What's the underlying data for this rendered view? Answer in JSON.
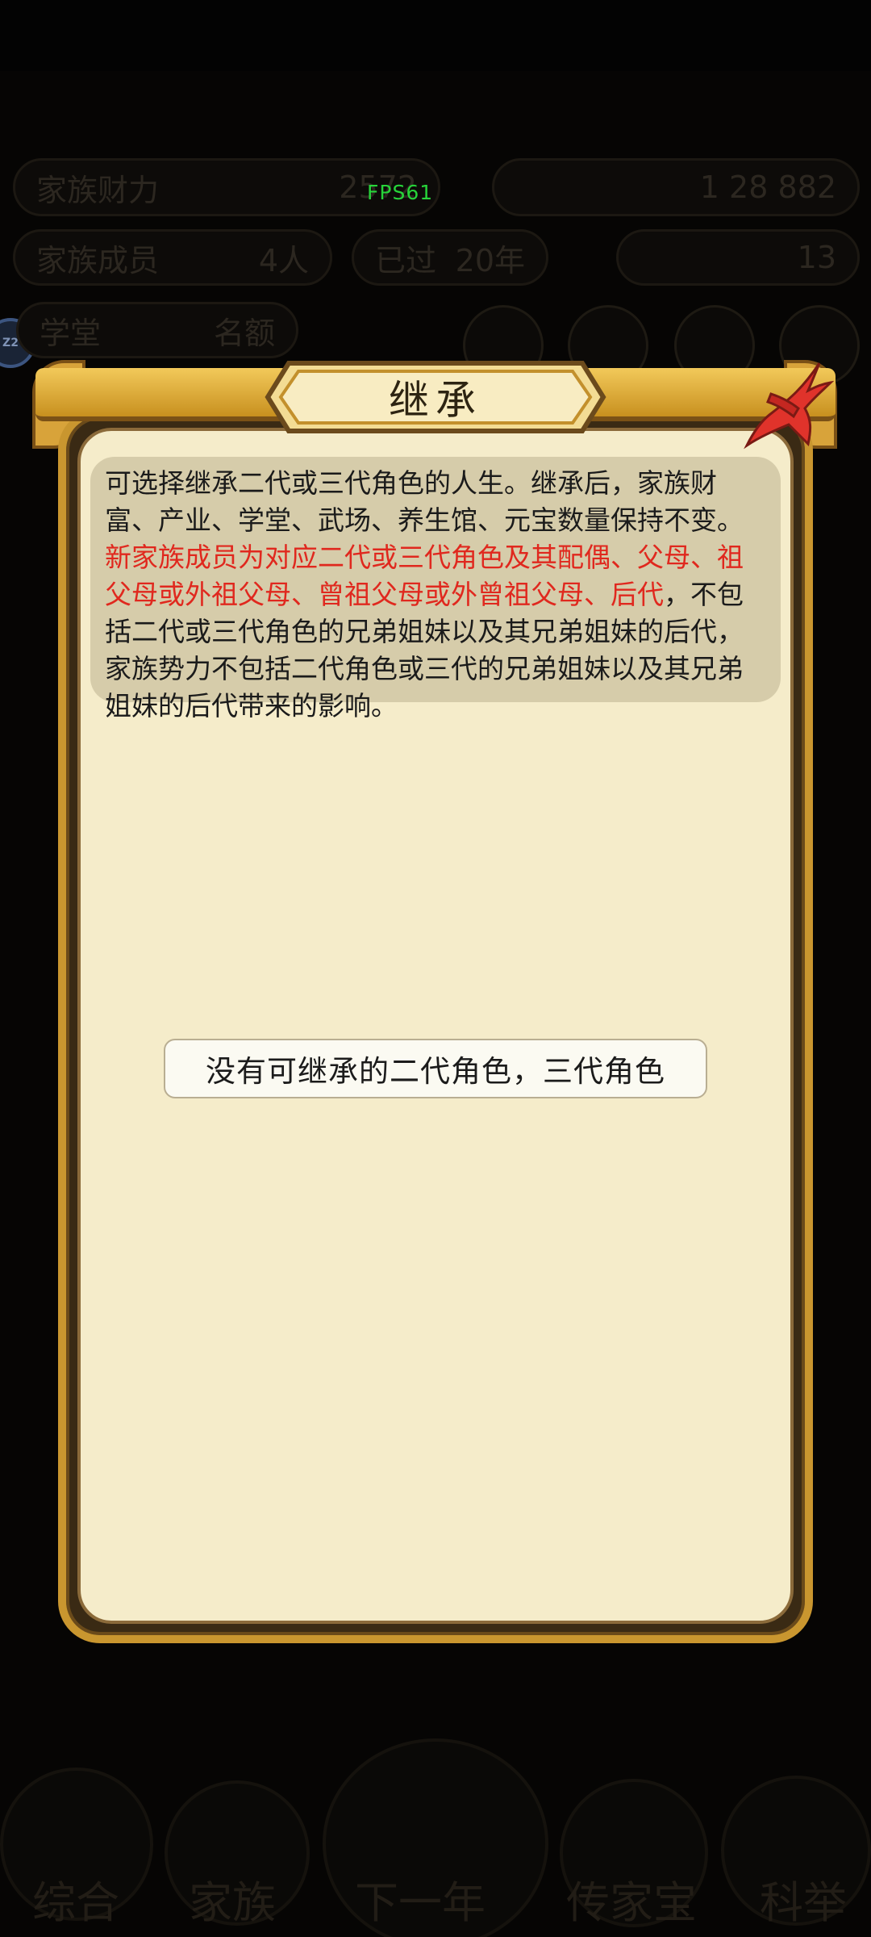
{
  "status": {
    "fps": "FPS61"
  },
  "background": {
    "stats_left": {
      "label": "家族财力",
      "value": "2572"
    },
    "stats_right": {
      "text": "1 28 882"
    },
    "members": {
      "label": "家族成员",
      "value": "4人"
    },
    "time": {
      "label": "已过",
      "value": "20年"
    },
    "currency": {
      "value": "13"
    },
    "scholar": {
      "label": "学堂",
      "value": "名额"
    },
    "avatar_label": "Z2"
  },
  "dialog": {
    "title": "继承",
    "info_plain_1": "可选择继承二代或三代角色的人生。继承后，家族财富、产业、学堂、武场、养生馆、元宝数量保持不变。",
    "info_red": "新家族成员为对应二代或三代角色及其配偶、父母、祖父母或外祖父母、曾祖父母或外曾祖父母、后代",
    "info_plain_2": "，不包括二代或三代角色的兄弟姐妹以及其兄弟姐妹的后代，家族势力不包括二代角色或三代的兄弟姐妹以及其兄弟姐妹的后代带来的影响。",
    "empty_message": "没有可继承的二代角色，三代角色",
    "close_icon": "close-x-icon"
  },
  "bottom_nav": {
    "items": [
      "综合",
      "家族",
      "下一年",
      "传家宝",
      "科举"
    ]
  },
  "colors": {
    "accent_red": "#e0281e",
    "frame_gold": "#c9962f",
    "parchment": "#f5ecca",
    "fps_green": "#27d43a"
  }
}
